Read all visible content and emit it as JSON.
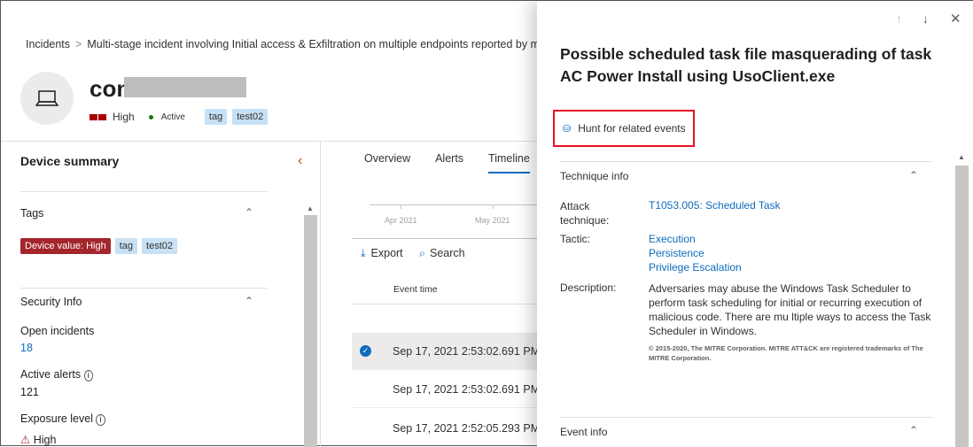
{
  "breadcrumb": {
    "root": "Incidents",
    "current": "Multi-stage incident involving Initial access & Exfiltration on multiple endpoints reported by multip"
  },
  "device": {
    "name": "con",
    "severity": "High",
    "status": "Active",
    "tags": [
      "tag",
      "test02"
    ]
  },
  "sidebar": {
    "title": "Device summary",
    "tags_title": "Tags",
    "tags": [
      "Device value: High",
      "tag",
      "test02"
    ],
    "security_title": "Security Info",
    "open_incidents_label": "Open incidents",
    "open_incidents": "18",
    "active_alerts_label": "Active alerts",
    "active_alerts": "121",
    "exposure_label": "Exposure level",
    "exposure": "High"
  },
  "main": {
    "tabs": [
      "Overview",
      "Alerts",
      "Timeline"
    ],
    "timeline_ticks": [
      "Apr 2021",
      "May 2021"
    ],
    "export": "Export",
    "search": "Search",
    "column": "Event time",
    "rows": [
      "Sep 17, 2021 2:53:02.691 PM",
      "Sep 17, 2021 2:53:02.691 PM",
      "Sep 17, 2021 2:52:05.293 PM"
    ]
  },
  "panel": {
    "title": "Possible scheduled task file masquerading of task AC Power Install using UsoClient.exe",
    "hunt": "Hunt for related events",
    "technique_title": "Technique info",
    "attack_label": "Attack technique:",
    "attack_value": "T1053.005: Scheduled Task",
    "tactic_label": "Tactic:",
    "tactics": [
      "Execution",
      "Persistence",
      "Privilege Escalation"
    ],
    "desc_label": "Description:",
    "description": "Adversaries may abuse the Windows Task Scheduler to perform task scheduling for initial or recurring execution of malicious code. There are mu ltiple ways to access the Task Scheduler in Windows.",
    "copyright": "© 2015-2020, The MITRE Corporation. MITRE ATT&CK are registered trademarks of The MITRE Corporation.",
    "event_title": "Event info"
  }
}
